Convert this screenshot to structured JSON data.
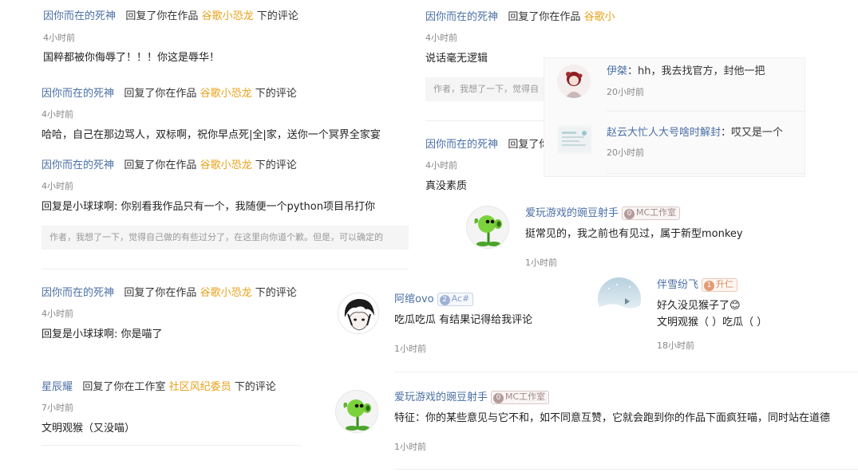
{
  "common": {
    "replied_in_work": "回复了你在作品",
    "below_comment": "下的评论"
  },
  "left": [
    {
      "user": "因你而在的死神",
      "work": "谷歌小恐龙",
      "time": "4小时前",
      "body": "国粹都被你侮辱了！！！你这是辱华！"
    },
    {
      "user": "因你而在的死神",
      "work": "谷歌小恐龙",
      "time": "4小时前",
      "body": "哈哈，自己在那边骂人，双标啊，祝你早点死|全|家，送你一个冥界全家宴"
    },
    {
      "user": "因你而在的死神",
      "work": "谷歌小恐龙",
      "time": "4小时前",
      "body": "回复是小球球啊:   你别看我作品只有一个，我随便一个python项目吊打你",
      "quote": "作者，我想了一下，觉得自己做的有些过分了，在这里向你道个歉。但是，可以确定的"
    },
    {
      "user": "因你而在的死神",
      "work": "谷歌小恐龙",
      "time": "4小时前",
      "body": "回复是小球球啊:   你是喵了"
    },
    {
      "user": "星辰耀",
      "action": "回复了你在工作室",
      "work": "社区风纪委员",
      "time": "7小时前",
      "body": "文明观猴（又没喵）"
    }
  ],
  "mid": [
    {
      "user": "因你而在的死神",
      "work": "谷歌小",
      "time": "4小时前",
      "body": "说话毫无逻辑",
      "quote": "作者，我想了一下，觉得自"
    },
    {
      "user": "因你而在的死神",
      "time": "4小时前",
      "body": "真没素质"
    }
  ],
  "overlay": [
    {
      "user": "伊桀",
      "text": "：hh，我去找官方，封他一把",
      "time": "20小时前"
    },
    {
      "user": "赵云大忙人大号啥时解封",
      "text": "：哎又是一个",
      "time": "20小时前"
    }
  ],
  "threads": {
    "pea1": {
      "user": "爱玩游戏的豌豆射手",
      "badge_level": "0",
      "badge_text": "MC工作室",
      "body": "挺常见的，我之前也有见过，属于新型monkey",
      "time": "1小时前"
    },
    "ovo": {
      "user": "阿绾ovo",
      "badge_level": "2",
      "badge_text": "Ac#",
      "body": "吃瓜吃瓜 有结果记得给我评论",
      "time": "1小时前"
    },
    "bxff": {
      "user": "伴雪纷飞",
      "badge_level": "1",
      "badge_text": "升仁",
      "body1": "好久没见猴子了😊",
      "body2": "文明观猴（ ）吃瓜（ ）",
      "time": "18小时前"
    },
    "pea2": {
      "user": "爱玩游戏的豌豆射手",
      "badge_level": "0",
      "badge_text": "MC工作室",
      "body": "特征：你的某些意见与它不和，如不同意互赞，它就会跑到你的作品下面疯狂喵，同时站在道德",
      "time": "1小时前"
    }
  },
  "icons": {
    "peashooter": "peashooter-avatar",
    "anime": "anime-boy-avatar",
    "snow": "snowy-landscape-avatar",
    "girl": "anime-girl-avatar",
    "doc": "document-thumbnail-avatar"
  },
  "colors": {
    "username": "#4a6fa5",
    "work_link": "#e8a21a",
    "time": "#888888"
  }
}
